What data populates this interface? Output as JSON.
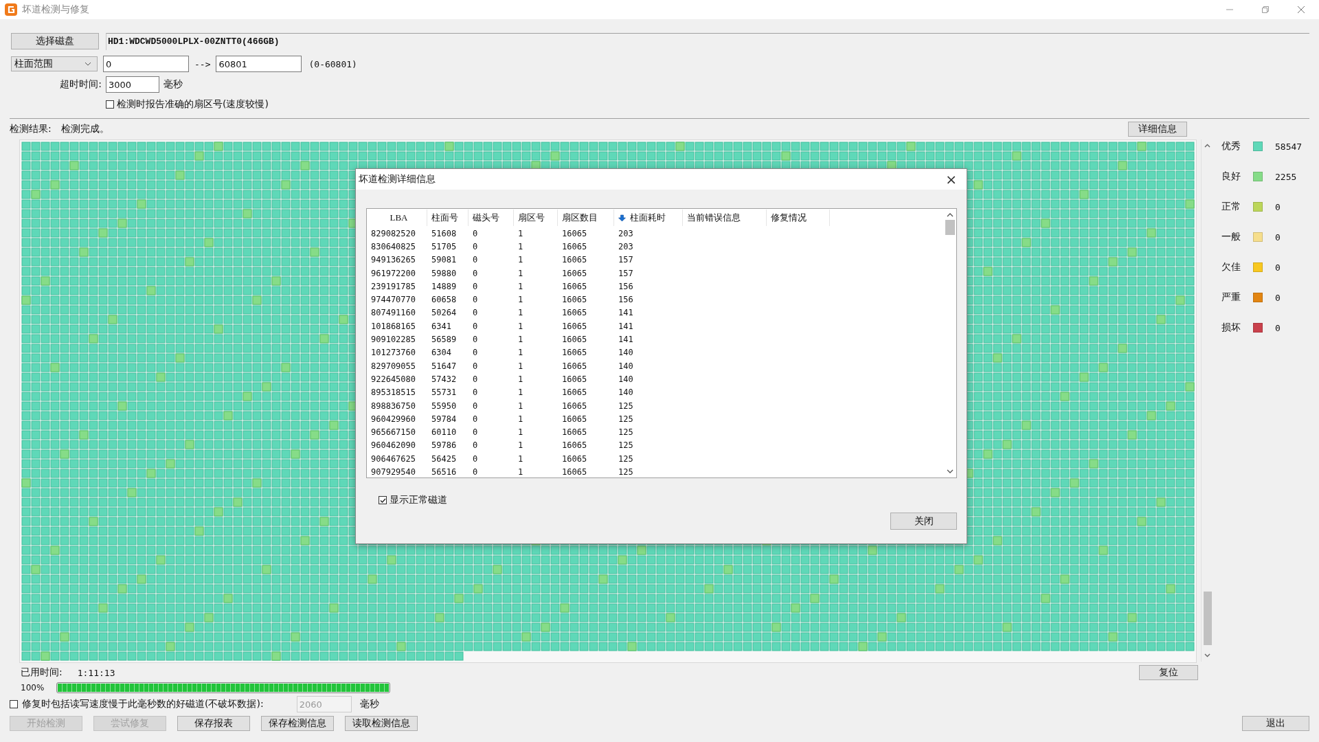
{
  "window": {
    "title": "坏道检测与修复"
  },
  "disk_button": "选择磁盘",
  "disk_name": "HD1:WDCWD5000LPLX-00ZNTT0(466GB)",
  "range": {
    "mode": "柱面范围",
    "from": "0",
    "arrow": "-->",
    "to": "60801",
    "hint": "(0-60801)"
  },
  "timeout": {
    "label": "超时时间:",
    "value": "3000",
    "unit": "毫秒"
  },
  "exact_sector_option": {
    "label": "检测时报告准确的扇区号(速度较慢)",
    "checked": false
  },
  "result": {
    "label": "检测结果:",
    "value": "检测完成。"
  },
  "details_button": "详细信息",
  "legend": [
    {
      "label": "优秀",
      "color": "#5fd8b8",
      "count": "58547"
    },
    {
      "label": "良好",
      "color": "#86dc88",
      "count": "2255"
    },
    {
      "label": "正常",
      "color": "#bcd65a",
      "count": "0"
    },
    {
      "label": "一般",
      "color": "#f6de8c",
      "count": "0"
    },
    {
      "label": "欠佳",
      "color": "#f8c820",
      "count": "0"
    },
    {
      "label": "严重",
      "color": "#e28512",
      "count": "0"
    },
    {
      "label": "损坏",
      "color": "#c9414c",
      "count": "0"
    }
  ],
  "elapsed": {
    "label": "已用时间:",
    "value": "1:11:13"
  },
  "progress": {
    "reading": "100%",
    "level": 1
  },
  "reset_button": "复位",
  "repair_option": {
    "label": "修复时包括读写速度慢于此毫秒数的好磁道(不破坏数据):",
    "checked": false,
    "value": "2060",
    "unit": "毫秒",
    "disabled": true
  },
  "buttons": [
    {
      "label": "开始检测",
      "disabled": true
    },
    {
      "label": "尝试修复",
      "disabled": true
    },
    {
      "label": "保存报表",
      "disabled": false
    },
    {
      "label": "保存检测信息",
      "disabled": false
    },
    {
      "label": "读取检测信息",
      "disabled": false
    }
  ],
  "exit_button": "退出",
  "dialog": {
    "title": "坏道检测详细信息",
    "close": "×",
    "columns": [
      "LBA",
      "柱面号",
      "磁头号",
      "扇区号",
      "扇区数目",
      "柱面耗时",
      "当前错误信息",
      "修复情况"
    ],
    "rows": [
      [
        "829082520",
        "51608",
        "0",
        "1",
        "16065",
        "203"
      ],
      [
        "830640825",
        "51705",
        "0",
        "1",
        "16065",
        "203"
      ],
      [
        "949136265",
        "59081",
        "0",
        "1",
        "16065",
        "157"
      ],
      [
        "961972200",
        "59880",
        "0",
        "1",
        "16065",
        "157"
      ],
      [
        "239191785",
        "14889",
        "0",
        "1",
        "16065",
        "156"
      ],
      [
        "974470770",
        "60658",
        "0",
        "1",
        "16065",
        "156"
      ],
      [
        "807491160",
        "50264",
        "0",
        "1",
        "16065",
        "141"
      ],
      [
        "101868165",
        "6341",
        "0",
        "1",
        "16065",
        "141"
      ],
      [
        "909102285",
        "56589",
        "0",
        "1",
        "16065",
        "141"
      ],
      [
        "101273760",
        "6304",
        "0",
        "1",
        "16065",
        "140"
      ],
      [
        "829709055",
        "51647",
        "0",
        "1",
        "16065",
        "140"
      ],
      [
        "922645080",
        "57432",
        "0",
        "1",
        "16065",
        "140"
      ],
      [
        "895318515",
        "55731",
        "0",
        "1",
        "16065",
        "140"
      ],
      [
        "898836750",
        "55950",
        "0",
        "1",
        "16065",
        "125"
      ],
      [
        "960429960",
        "59784",
        "0",
        "1",
        "16065",
        "125"
      ],
      [
        "965667150",
        "60110",
        "0",
        "1",
        "16065",
        "125"
      ],
      [
        "960462090",
        "59786",
        "0",
        "1",
        "16065",
        "125"
      ],
      [
        "906467625",
        "56425",
        "0",
        "1",
        "16065",
        "125"
      ],
      [
        "907929540",
        "56516",
        "0",
        "1",
        "16065",
        "125"
      ]
    ],
    "show_normal": {
      "label": "显示正常磁道",
      "checked": true
    },
    "close_button": "关闭"
  }
}
